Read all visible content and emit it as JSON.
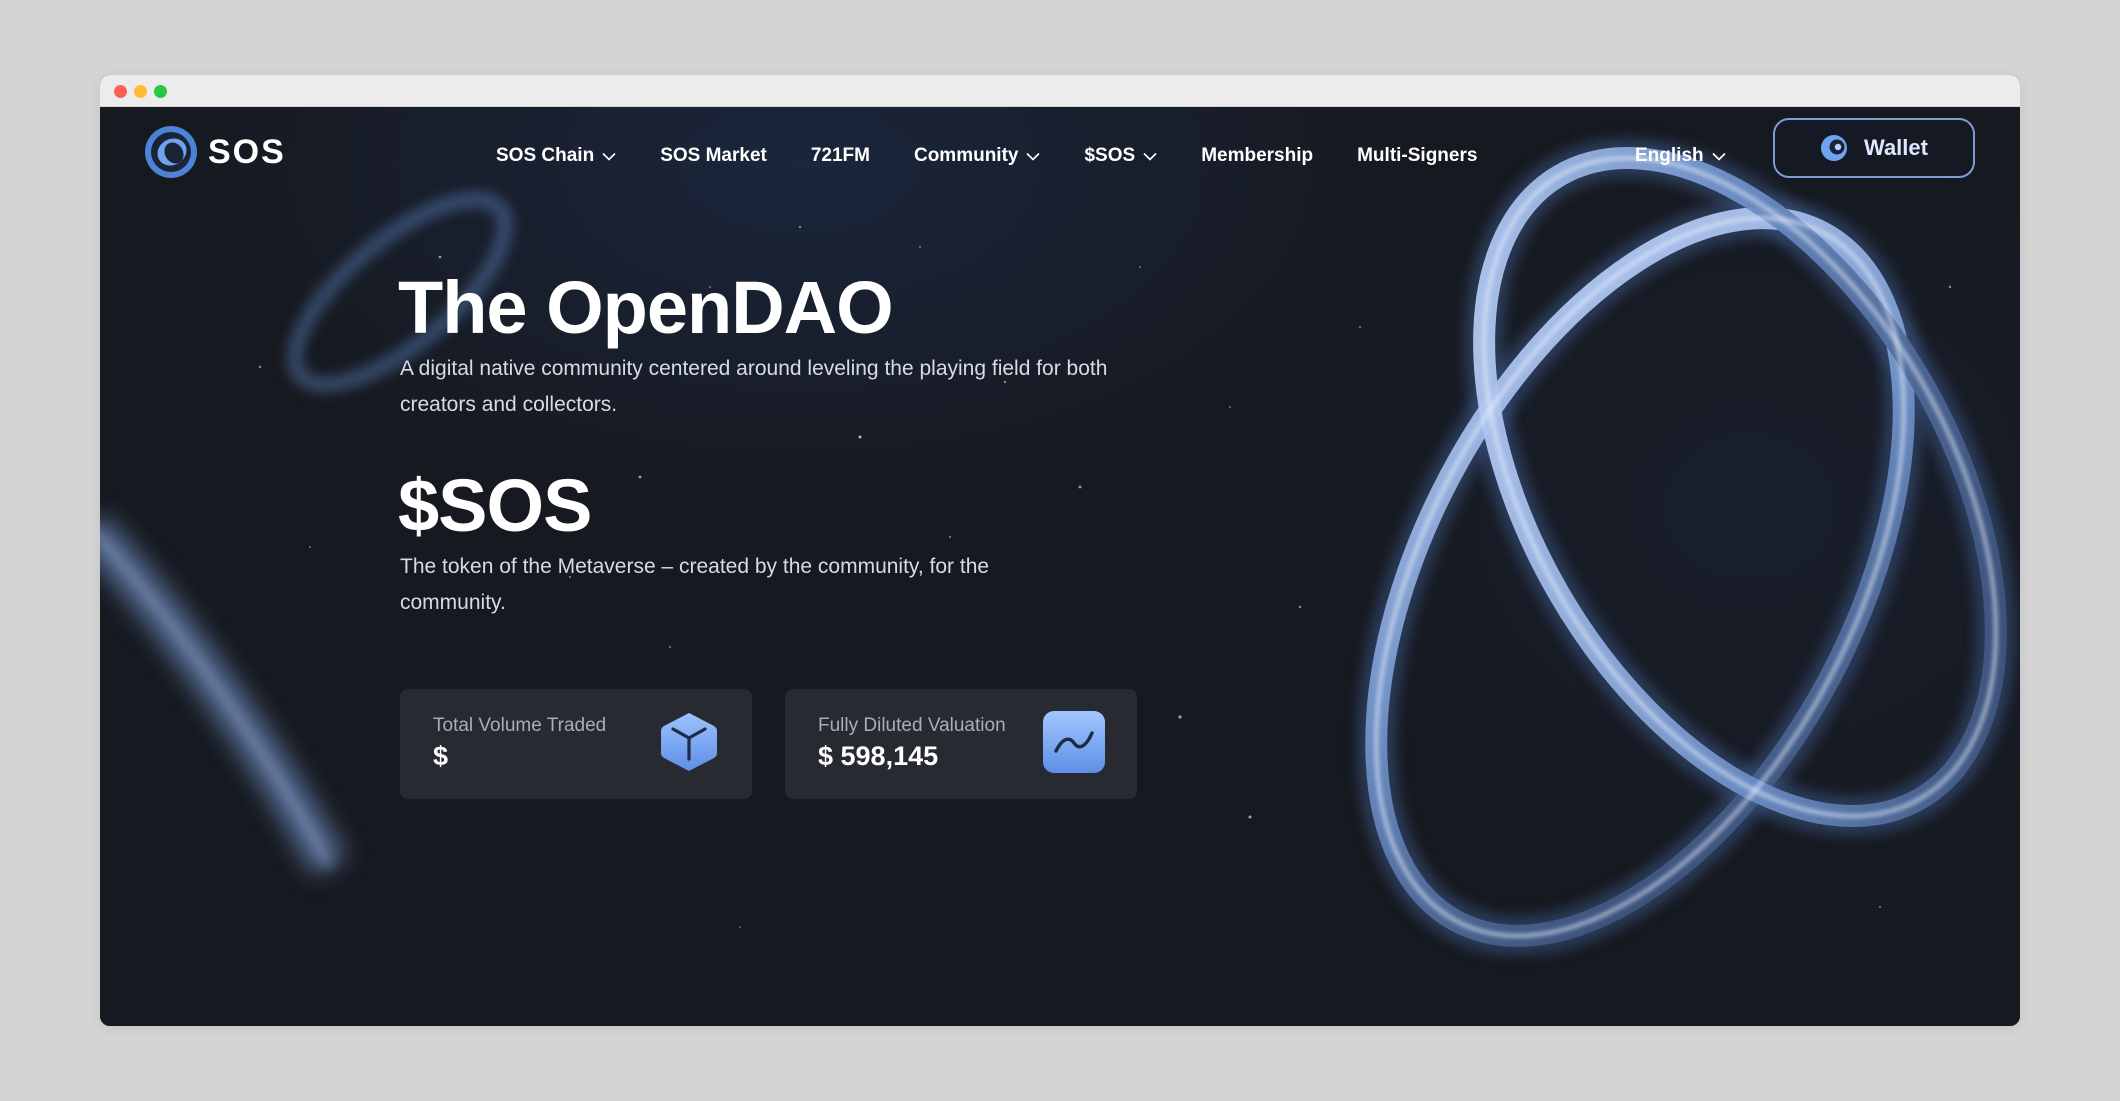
{
  "header": {
    "logo_text": "SOS",
    "nav": [
      {
        "label": "SOS Chain",
        "has_dropdown": true
      },
      {
        "label": "SOS Market",
        "has_dropdown": false
      },
      {
        "label": "721FM",
        "has_dropdown": false
      },
      {
        "label": "Community",
        "has_dropdown": true
      },
      {
        "label": "$SOS",
        "has_dropdown": true
      },
      {
        "label": "Membership",
        "has_dropdown": false
      },
      {
        "label": "Multi-Signers",
        "has_dropdown": false
      }
    ],
    "language": "English",
    "wallet_label": "Wallet"
  },
  "hero": {
    "title": "The OpenDAO",
    "subtitle": "A digital native community centered around leveling the playing field for both creators and collectors.",
    "token_title": "$SOS",
    "token_subtitle": "The token of the Metaverse – created by the community, for the community."
  },
  "stats": [
    {
      "label": "Total Volume Traded",
      "value": "$",
      "icon": "cube-icon"
    },
    {
      "label": "Fully Diluted Valuation",
      "value": "$ 598,145",
      "icon": "trend-line-icon"
    }
  ],
  "colors": {
    "background": "#16191f",
    "card": "#272a31",
    "accent_blue": "#6e9eee",
    "wallet_border": "#7f9cd6",
    "text_primary": "#ffffff",
    "text_muted": "#a9adb6"
  }
}
